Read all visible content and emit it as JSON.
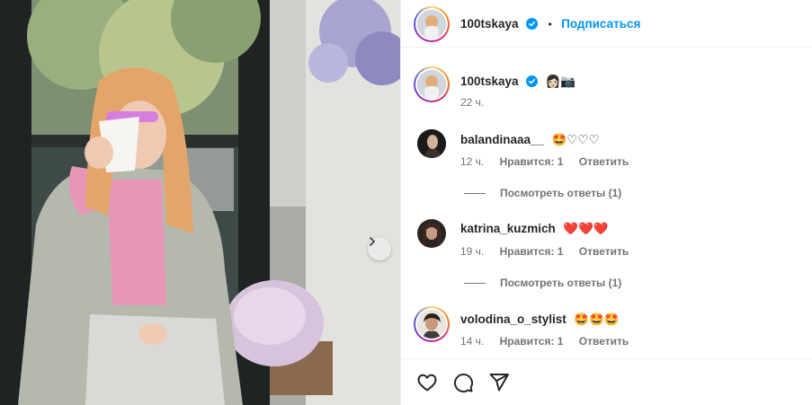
{
  "post": {
    "author": "100tskaya",
    "header_separator": "•",
    "follow_label": "Подписаться",
    "caption_emojis": "👩🏻📷",
    "caption_time": "22 ч."
  },
  "comments": [
    {
      "username": "balandinaaa__",
      "text": "🤩♡♡♡",
      "time": "12 ч.",
      "likes": "Нравится: 1",
      "reply": "Ответить",
      "view_replies": "Посмотреть ответы (1)"
    },
    {
      "username": "katrina_kuzmich",
      "text": "❤️❤️❤️",
      "time": "19 ч.",
      "likes": "Нравится: 1",
      "reply": "Ответить",
      "view_replies": "Посмотреть ответы (1)"
    },
    {
      "username": "volodina_o_stylist",
      "text": "🤩🤩🤩",
      "time": "14 ч.",
      "likes": "Нравится: 1",
      "reply": "Ответить"
    }
  ],
  "icons": {
    "verified": "verified-badge-icon",
    "like": "heart-icon",
    "comment": "comment-icon",
    "share": "share-icon",
    "next": "chevron-right-icon"
  },
  "colors": {
    "accent": "#0095f6",
    "text": "#262626",
    "secondary": "#737373"
  }
}
